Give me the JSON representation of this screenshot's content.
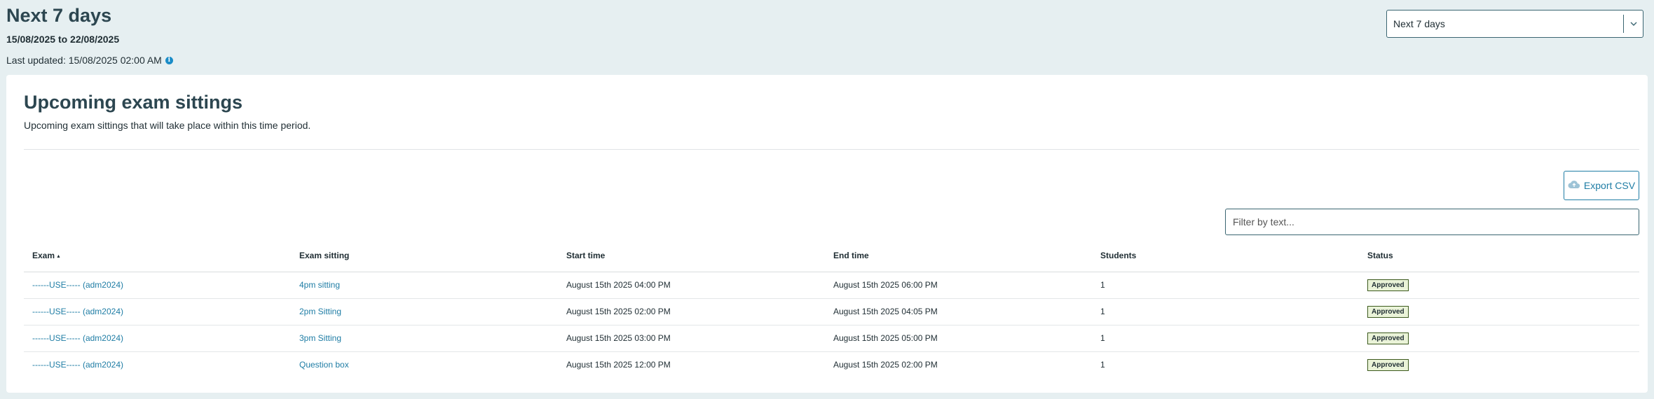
{
  "header": {
    "title": "Next 7 days",
    "date_range": "15/08/2025 to 22/08/2025",
    "last_updated": "Last updated: 15/08/2025 02:00 AM",
    "info_icon_glyph": "i"
  },
  "period_select": {
    "value": "Next 7 days"
  },
  "card": {
    "title": "Upcoming exam sittings",
    "subtitle": "Upcoming exam sittings that will take place within this time period.",
    "export_label": "Export CSV",
    "filter_placeholder": "Filter by text..."
  },
  "table": {
    "headers": {
      "exam": "Exam",
      "sitting": "Exam sitting",
      "start": "Start time",
      "end": "End time",
      "students": "Students",
      "status": "Status"
    },
    "sort_glyph": "▲",
    "rows": [
      {
        "exam": "------USE----- (adm2024)",
        "sitting": "4pm sitting",
        "start": "August 15th 2025 04:00 PM",
        "end": "August 15th 2025 06:00 PM",
        "students": "1",
        "status": "Approved"
      },
      {
        "exam": "------USE----- (adm2024)",
        "sitting": "2pm Sitting",
        "start": "August 15th 2025 02:00 PM",
        "end": "August 15th 2025 04:05 PM",
        "students": "1",
        "status": "Approved"
      },
      {
        "exam": "------USE----- (adm2024)",
        "sitting": "3pm Sitting",
        "start": "August 15th 2025 03:00 PM",
        "end": "August 15th 2025 05:00 PM",
        "students": "1",
        "status": "Approved"
      },
      {
        "exam": "------USE----- (adm2024)",
        "sitting": "Question box",
        "start": "August 15th 2025 12:00 PM",
        "end": "August 15th 2025 02:00 PM",
        "students": "1",
        "status": "Approved"
      }
    ]
  },
  "colors": {
    "page_bg": "#e6eff1",
    "heading": "#2c4650",
    "link": "#1f7da5",
    "info": "#1a8cc7",
    "badge_bg": "#eaf3d8",
    "badge_border": "#3d5a1e"
  },
  "icons": {
    "info": "info-icon",
    "chevron": "chevron-down-icon",
    "export": "cloud-upload-icon"
  }
}
